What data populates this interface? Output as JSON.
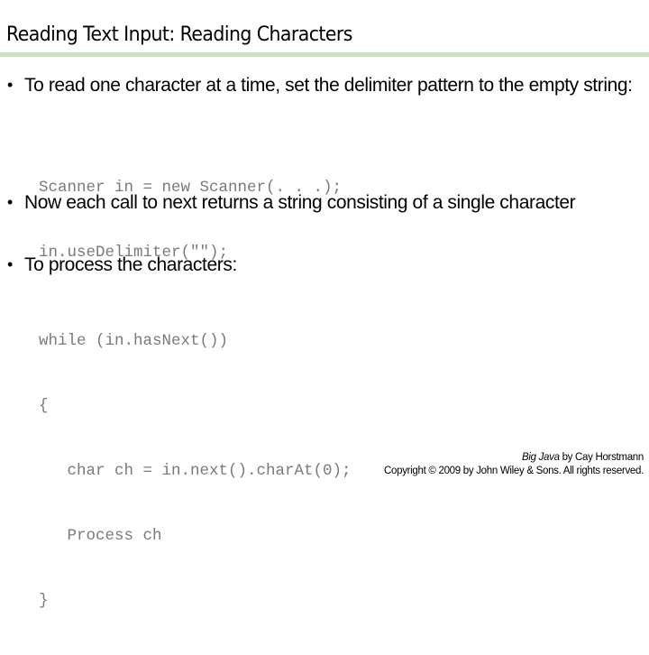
{
  "slide": {
    "title": "Reading Text Input: Reading Characters",
    "accent_rule_color": "#c8e4bb",
    "bullets": [
      {
        "text": "To read one character at a time, set the delimiter pattern to the empty string:",
        "code": [
          "Scanner in = new Scanner(. . .);",
          "in.useDelimiter(\"\");"
        ]
      },
      {
        "text": "Now each call to next returns a string consisting of a single character",
        "code": []
      },
      {
        "text": "To process the characters:",
        "code": [
          "while (in.hasNext())",
          "{",
          "   char ch = in.next().charAt(0);",
          "   Process ch",
          "}"
        ]
      }
    ],
    "bullet_glyph": "•",
    "footer": {
      "book_title": "Big Java",
      "author_line": " by Cay Horstmann",
      "copyright": "Copyright © 2009 by John Wiley & Sons.  All rights reserved."
    }
  }
}
